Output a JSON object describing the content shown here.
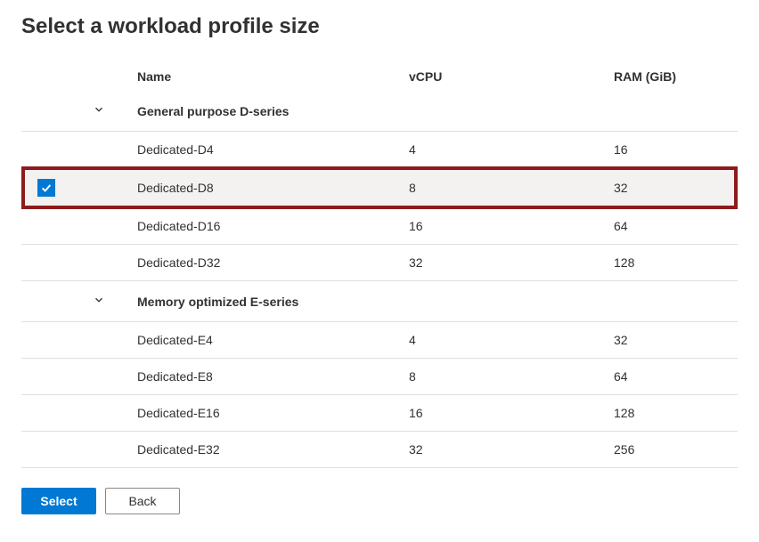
{
  "title": "Select a workload profile size",
  "columns": {
    "name": "Name",
    "vcpu": "vCPU",
    "ram": "RAM (GiB)"
  },
  "groups": [
    {
      "label": "General purpose D-series",
      "rows": [
        {
          "name": "Dedicated-D4",
          "vcpu": "4",
          "ram": "16",
          "selected": false
        },
        {
          "name": "Dedicated-D8",
          "vcpu": "8",
          "ram": "32",
          "selected": true
        },
        {
          "name": "Dedicated-D16",
          "vcpu": "16",
          "ram": "64",
          "selected": false
        },
        {
          "name": "Dedicated-D32",
          "vcpu": "32",
          "ram": "128",
          "selected": false
        }
      ]
    },
    {
      "label": "Memory optimized E-series",
      "rows": [
        {
          "name": "Dedicated-E4",
          "vcpu": "4",
          "ram": "32",
          "selected": false
        },
        {
          "name": "Dedicated-E8",
          "vcpu": "8",
          "ram": "64",
          "selected": false
        },
        {
          "name": "Dedicated-E16",
          "vcpu": "16",
          "ram": "128",
          "selected": false
        },
        {
          "name": "Dedicated-E32",
          "vcpu": "32",
          "ram": "256",
          "selected": false
        }
      ]
    }
  ],
  "buttons": {
    "select": "Select",
    "back": "Back"
  },
  "colors": {
    "accent": "#0078d4",
    "highlight_border": "#8d1b1b"
  }
}
